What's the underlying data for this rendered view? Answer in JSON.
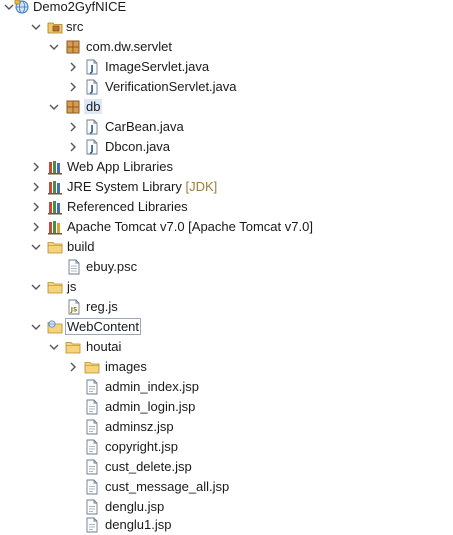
{
  "tree": {
    "project": "Demo2GyfNICE",
    "src": "src",
    "pkg_servlet": "com.dw.servlet",
    "image_servlet": "ImageServlet.java",
    "verification_servlet": "VerificationServlet.java",
    "pkg_db": "db",
    "carbean": "CarBean.java",
    "dbcon": "Dbcon.java",
    "webapp_libs": "Web App Libraries",
    "jre_lib": "JRE System Library",
    "jre_deco": "[JDK]",
    "ref_libs": "Referenced Libraries",
    "tomcat": "Apache Tomcat v7.0 [Apache Tomcat v7.0]",
    "build": "build",
    "ebuy": "ebuy.psc",
    "js": "js",
    "regjs": "reg.js",
    "webcontent": "WebContent",
    "houtai": "houtai",
    "images": "images",
    "admin_index": "admin_index.jsp",
    "admin_login": "admin_login.jsp",
    "adminsz": "adminsz.jsp",
    "copyright": "copyright.jsp",
    "cust_delete": "cust_delete.jsp",
    "cust_message_all": "cust_message_all.jsp",
    "denglu": "denglu.jsp",
    "denglu1": "denglu1.jsp"
  },
  "icons": {
    "twisty_open": "chevron-down-icon",
    "twisty_closed": "chevron-right-icon",
    "project": "dynamic-web-project-icon",
    "source_folder": "source-folder-icon",
    "package": "package-icon",
    "java_file": "java-file-icon",
    "library": "library-icon",
    "server": "server-runtime-icon",
    "folder": "folder-icon",
    "file": "text-file-icon",
    "js_file": "javascript-file-icon",
    "web_folder": "web-content-folder-icon",
    "jsp_file": "jsp-file-icon"
  },
  "colors": {
    "folder": "#e8b84b",
    "package": "#b87333",
    "java": "#2f5fa8",
    "decoration": "#9b7d3c",
    "selection": "#dbe9f7"
  }
}
